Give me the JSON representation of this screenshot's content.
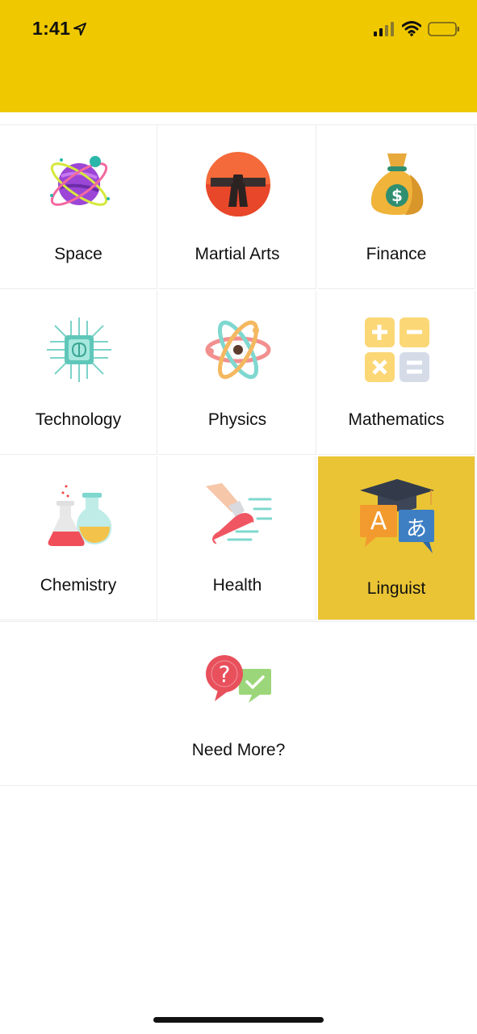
{
  "status_bar": {
    "time": "1:41",
    "icons": [
      "location-arrow-icon",
      "cellular-signal-icon",
      "wifi-icon",
      "battery-icon"
    ]
  },
  "colors": {
    "header": "#efc800",
    "selected_cell": "#eac434"
  },
  "categories": [
    {
      "label": "Space",
      "icon": "planet-icon"
    },
    {
      "label": "Martial Arts",
      "icon": "martial-arts-belt-icon"
    },
    {
      "label": "Finance",
      "icon": "money-bag-icon"
    },
    {
      "label": "Technology",
      "icon": "microchip-brain-icon"
    },
    {
      "label": "Physics",
      "icon": "atom-icon"
    },
    {
      "label": "Mathematics",
      "icon": "math-operators-icon"
    },
    {
      "label": "Chemistry",
      "icon": "flasks-icon"
    },
    {
      "label": "Health",
      "icon": "running-shoe-icon"
    },
    {
      "label": "Linguist",
      "icon": "language-graduation-icon",
      "selected": true
    }
  ],
  "more": {
    "label": "Need More?",
    "icon": "question-chat-icon"
  }
}
